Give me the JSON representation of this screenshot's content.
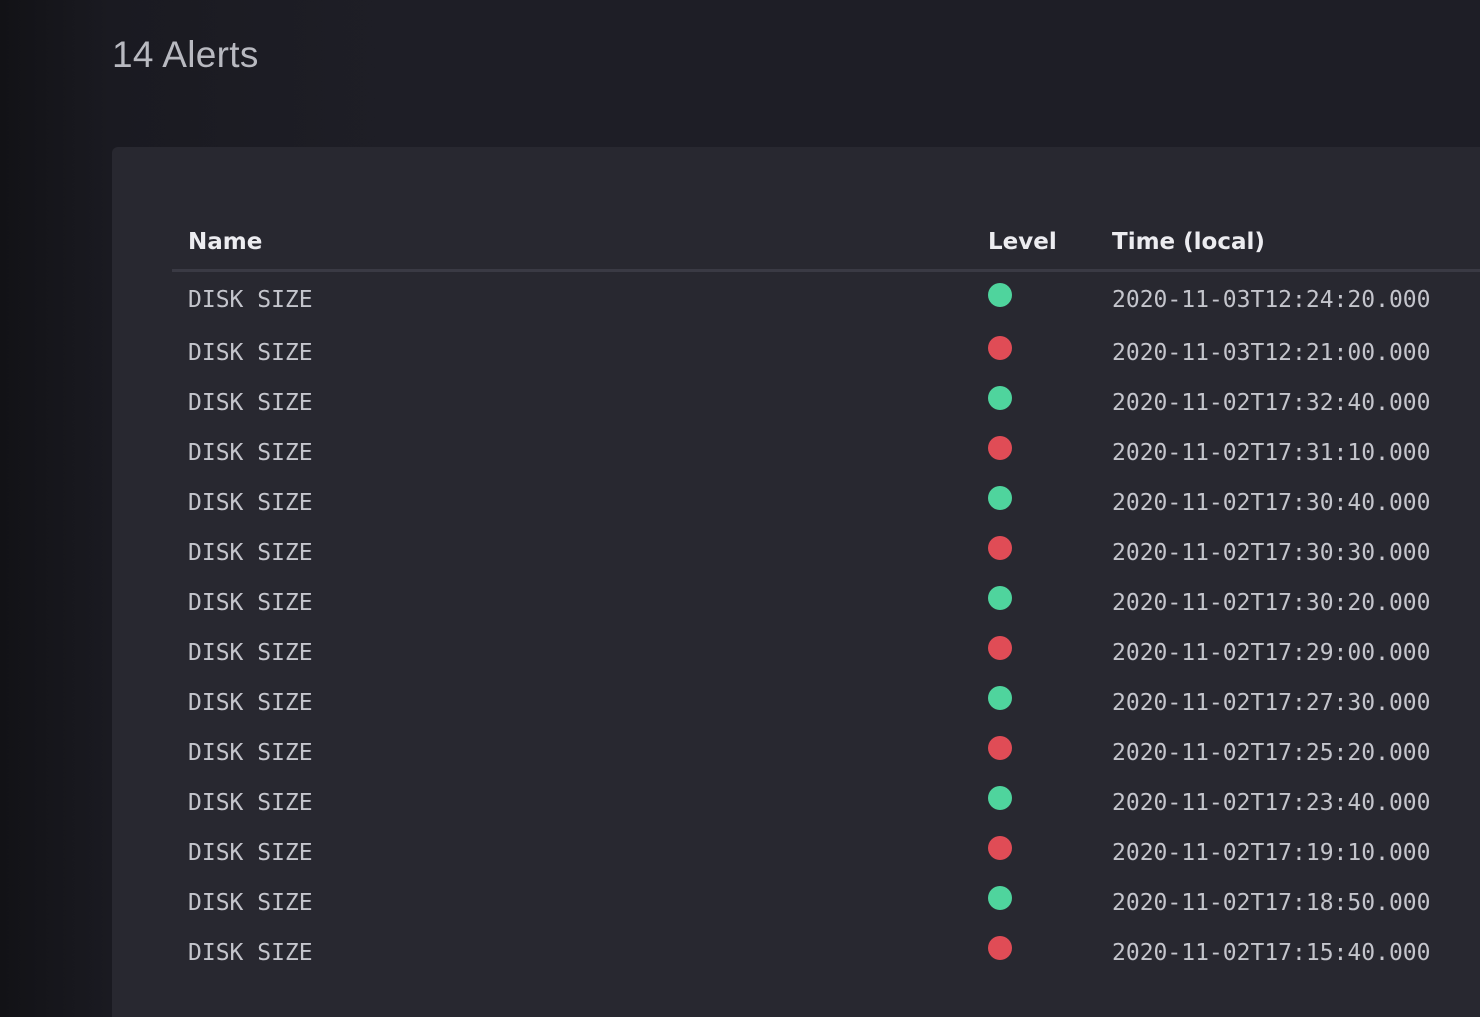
{
  "page": {
    "title": "14 Alerts"
  },
  "table": {
    "columns": {
      "name": "Name",
      "level": "Level",
      "time": "Time (local)"
    },
    "level_colors": {
      "ok": "#4fd49d",
      "crit": "#e04c56"
    },
    "rows": [
      {
        "name": "DISK SIZE",
        "level": "ok",
        "time": "2020-11-03T12:24:20.000"
      },
      {
        "name": "DISK SIZE",
        "level": "crit",
        "time": "2020-11-03T12:21:00.000"
      },
      {
        "name": "DISK SIZE",
        "level": "ok",
        "time": "2020-11-02T17:32:40.000"
      },
      {
        "name": "DISK SIZE",
        "level": "crit",
        "time": "2020-11-02T17:31:10.000"
      },
      {
        "name": "DISK SIZE",
        "level": "ok",
        "time": "2020-11-02T17:30:40.000"
      },
      {
        "name": "DISK SIZE",
        "level": "crit",
        "time": "2020-11-02T17:30:30.000"
      },
      {
        "name": "DISK SIZE",
        "level": "ok",
        "time": "2020-11-02T17:30:20.000"
      },
      {
        "name": "DISK SIZE",
        "level": "crit",
        "time": "2020-11-02T17:29:00.000"
      },
      {
        "name": "DISK SIZE",
        "level": "ok",
        "time": "2020-11-02T17:27:30.000"
      },
      {
        "name": "DISK SIZE",
        "level": "crit",
        "time": "2020-11-02T17:25:20.000"
      },
      {
        "name": "DISK SIZE",
        "level": "ok",
        "time": "2020-11-02T17:23:40.000"
      },
      {
        "name": "DISK SIZE",
        "level": "crit",
        "time": "2020-11-02T17:19:10.000"
      },
      {
        "name": "DISK SIZE",
        "level": "ok",
        "time": "2020-11-02T17:18:50.000"
      },
      {
        "name": "DISK SIZE",
        "level": "crit",
        "time": "2020-11-02T17:15:40.000"
      }
    ]
  }
}
